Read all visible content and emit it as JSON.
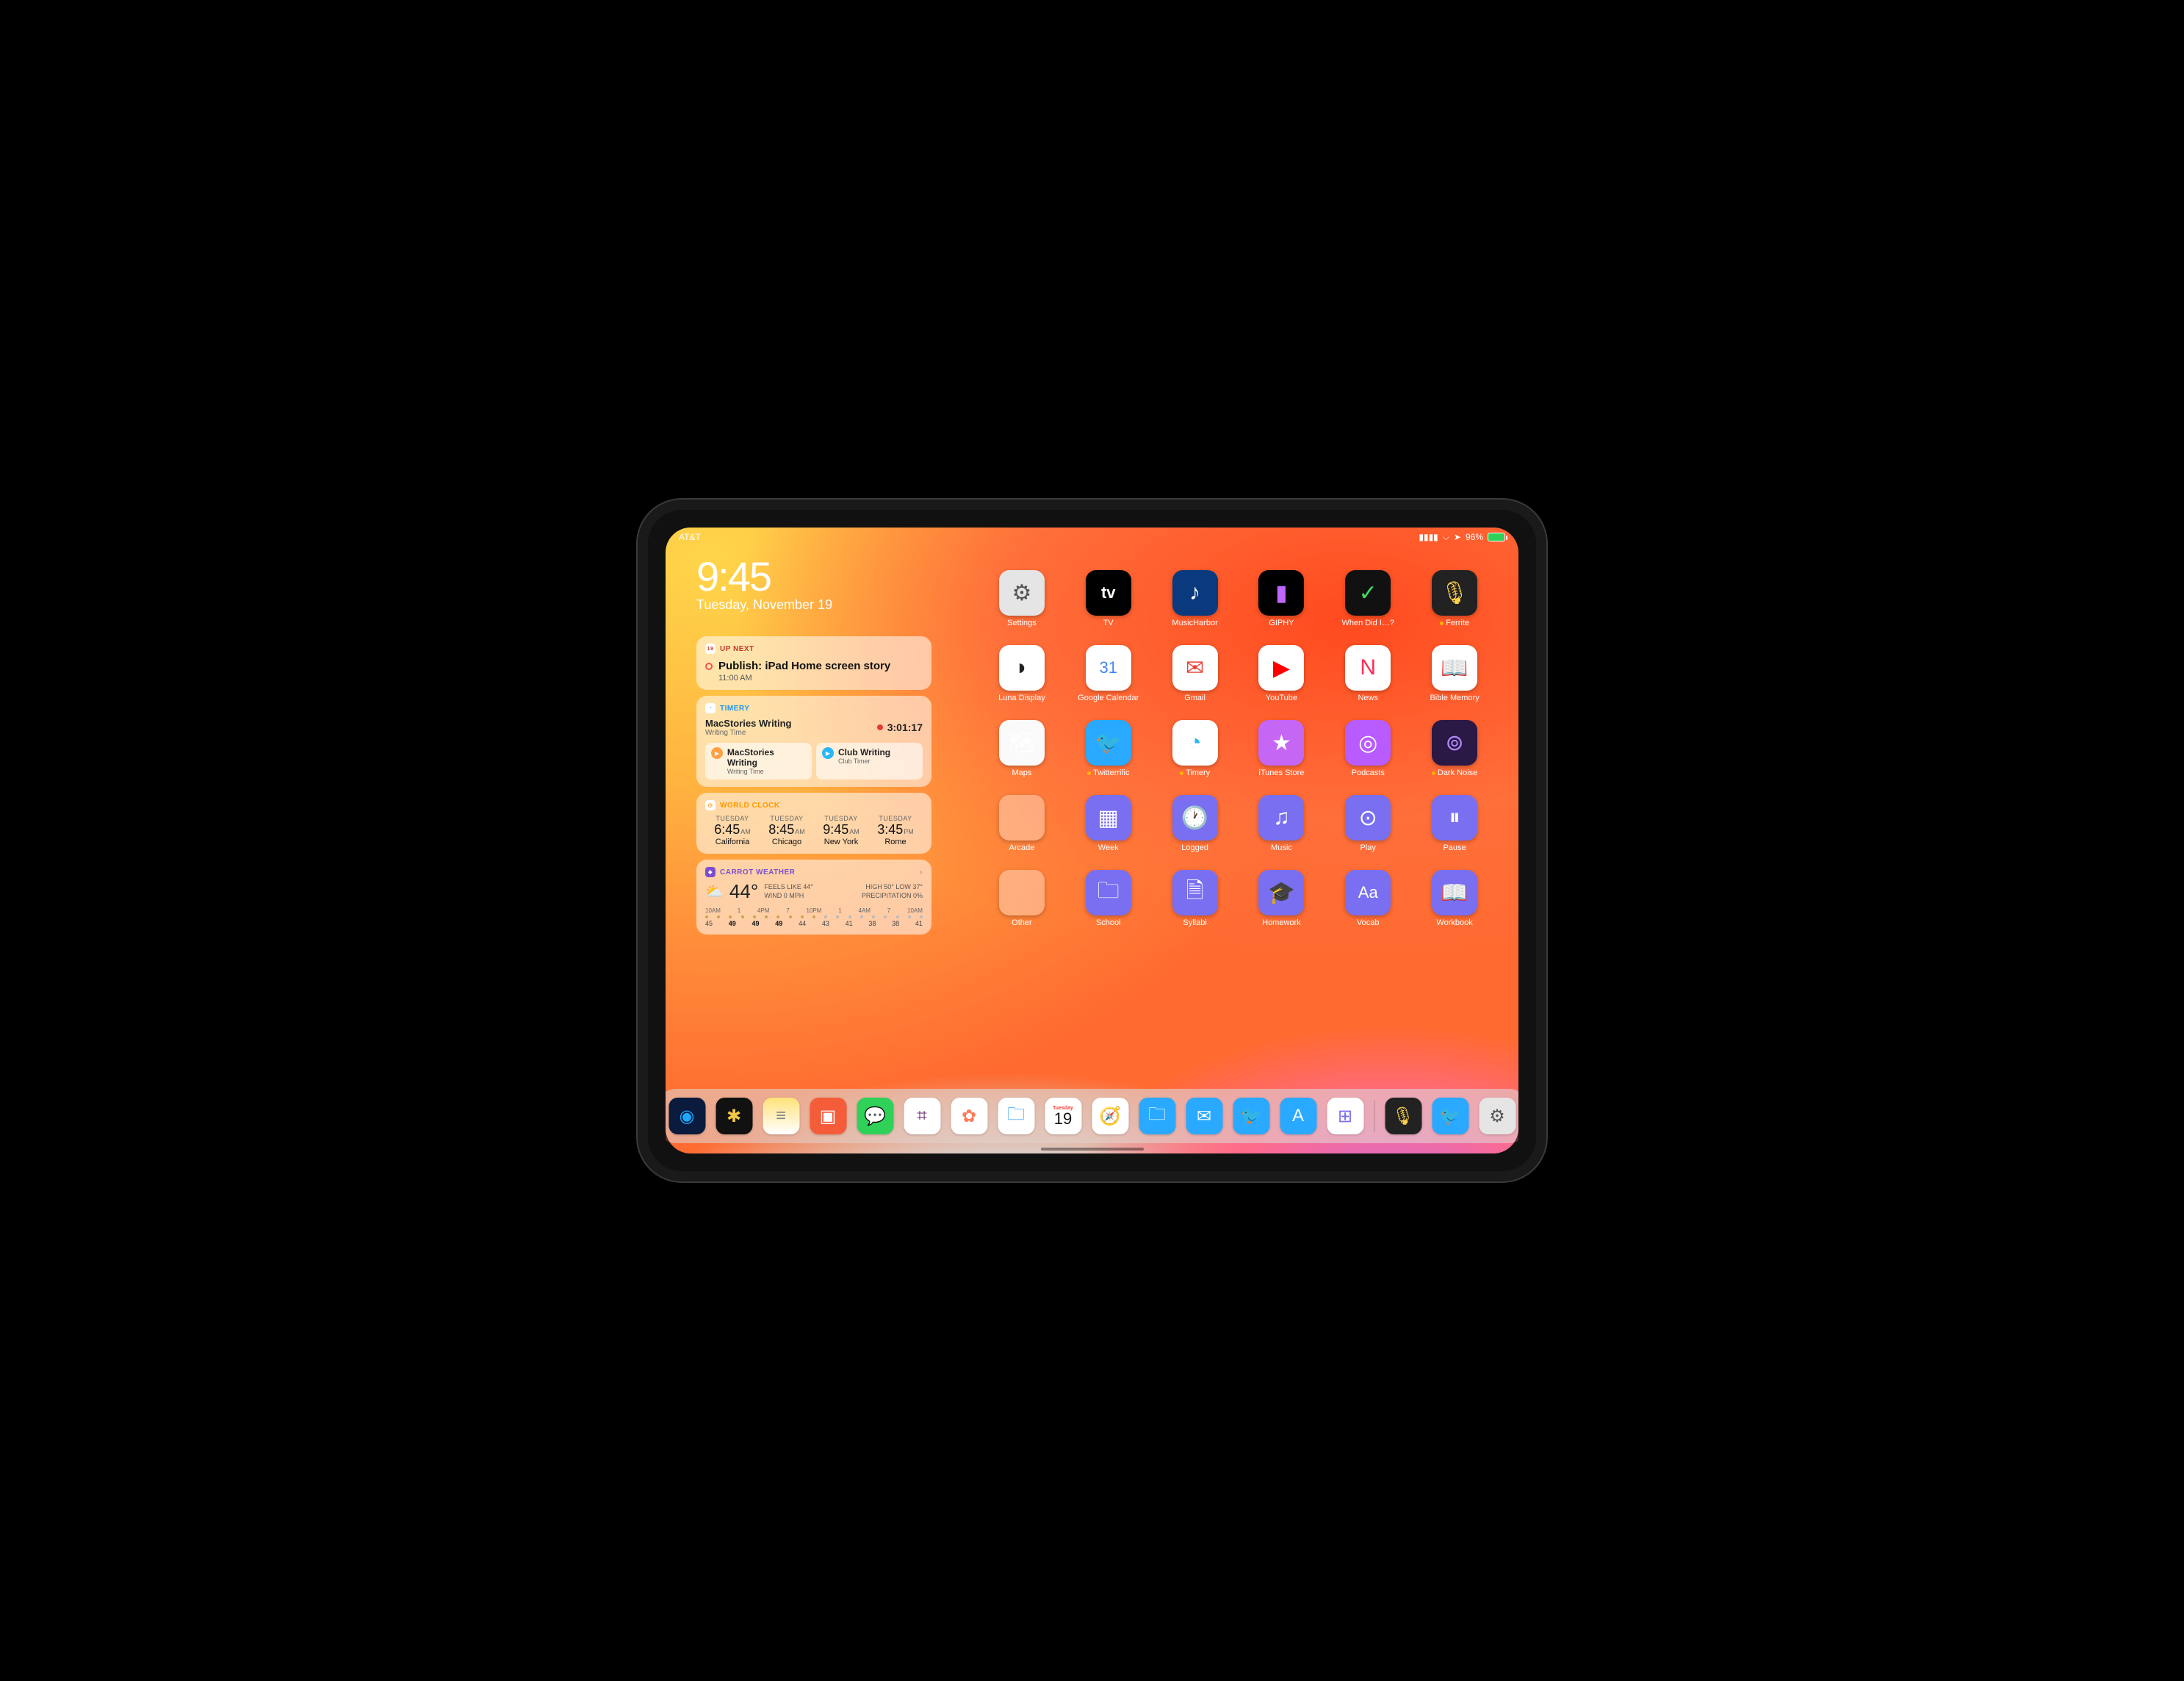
{
  "status": {
    "carrier": "AT&T",
    "battery_pct": "96%"
  },
  "clock": {
    "time": "9:45",
    "date": "Tuesday, November 19"
  },
  "widgets": {
    "upnext": {
      "label": "UP NEXT",
      "badge": "19",
      "event_title": "Publish: iPad Home screen story",
      "event_time": "11:00 AM"
    },
    "timery": {
      "label": "TIMERY",
      "project": "MacStories Writing",
      "task": "Writing Time",
      "elapsed": "3:01:17",
      "btn1_project": "MacStories Writing",
      "btn1_task": "Writing Time",
      "btn2_project": "Club Writing",
      "btn2_task": "Club Timer"
    },
    "worldclock": {
      "label": "WORLD CLOCK",
      "cities": [
        {
          "day": "TUESDAY",
          "time": "6:45",
          "ampm": "AM",
          "name": "California"
        },
        {
          "day": "TUESDAY",
          "time": "8:45",
          "ampm": "AM",
          "name": "Chicago"
        },
        {
          "day": "TUESDAY",
          "time": "9:45",
          "ampm": "AM",
          "name": "New York"
        },
        {
          "day": "TUESDAY",
          "time": "3:45",
          "ampm": "PM",
          "name": "Rome"
        }
      ]
    },
    "weather": {
      "label": "CARROT WEATHER",
      "temp": "44°",
      "feels": "FEELS LIKE 44°",
      "wind": "WIND 0 MPH",
      "high": "HIGH 50°",
      "low": "LOW 37°",
      "precip": "PRECIPITATION 0%",
      "hours": [
        "10AM",
        "1",
        "4PM",
        "7",
        "10PM",
        "1",
        "4AM",
        "7",
        "10AM"
      ],
      "temps": [
        "45",
        "49",
        "49",
        "49",
        "44",
        "43",
        "41",
        "38",
        "38",
        "41"
      ]
    }
  },
  "apps": [
    {
      "name": "Settings",
      "icon": "⚙",
      "bg": "#e5e5e5",
      "fg": "#555"
    },
    {
      "name": "TV",
      "icon": "tv",
      "bg": "#000"
    },
    {
      "name": "MusicHarbor",
      "icon": "♪",
      "bg": "#0a3a7d"
    },
    {
      "name": "GIPHY",
      "icon": "▮",
      "bg": "#000",
      "fg": "#c066ff"
    },
    {
      "name": "When Did I…?",
      "icon": "✓",
      "bg": "#111",
      "fg": "#40e060"
    },
    {
      "name": "Ferrite",
      "icon": "🎙",
      "bg": "#222",
      "fg": "#ffd24a",
      "ind": true
    },
    {
      "name": "Luna Display",
      "icon": "◗",
      "bg": "#fff",
      "fg": "#222"
    },
    {
      "name": "Google Calendar",
      "icon": "31",
      "bg": "#fff",
      "fg": "#4285f4"
    },
    {
      "name": "Gmail",
      "icon": "✉",
      "bg": "#fff",
      "fg": "#ea4335"
    },
    {
      "name": "YouTube",
      "icon": "▶",
      "bg": "#fff",
      "fg": "#ff0000"
    },
    {
      "name": "News",
      "icon": "N",
      "bg": "#fff",
      "fg": "#ff2d55"
    },
    {
      "name": "Bible Memory",
      "icon": "📖",
      "bg": "#fff",
      "fg": "#d9303a"
    },
    {
      "name": "Maps",
      "icon": "🗺",
      "bg": "#fafafa"
    },
    {
      "name": "Twitterrific",
      "icon": "🐦",
      "bg": "#29a9ff",
      "ind": true
    },
    {
      "name": "Timery",
      "icon": "◔",
      "bg": "#fff",
      "fg": "#29b6f6",
      "ind": true
    },
    {
      "name": "iTunes Store",
      "icon": "★",
      "bg": "#c566f5"
    },
    {
      "name": "Podcasts",
      "icon": "◎",
      "bg": "#b95cff"
    },
    {
      "name": "Dark Noise",
      "icon": "⊚",
      "bg": "#2a1845",
      "fg": "#b18cff",
      "ind": true
    },
    {
      "name": "Arcade",
      "folder": true
    },
    {
      "name": "Week",
      "icon": "▦",
      "bg": "#7a6ff0"
    },
    {
      "name": "Logged",
      "icon": "🕐",
      "bg": "#7a6ff0"
    },
    {
      "name": "Music",
      "icon": "♫",
      "bg": "#7a6ff0"
    },
    {
      "name": "Play",
      "icon": "⊙",
      "bg": "#7a6ff0"
    },
    {
      "name": "Pause",
      "icon": "⏸",
      "bg": "#7a6ff0"
    },
    {
      "name": "Other",
      "folder": true
    },
    {
      "name": "School",
      "icon": "🗀",
      "bg": "#7a6ff0"
    },
    {
      "name": "Syllabi",
      "icon": "🗎",
      "bg": "#7a6ff0"
    },
    {
      "name": "Homework",
      "icon": "🎓",
      "bg": "#7a6ff0"
    },
    {
      "name": "Vocab",
      "icon": "Aa",
      "bg": "#7a6ff0"
    },
    {
      "name": "Workbook",
      "icon": "📖",
      "bg": "#7a6ff0"
    }
  ],
  "dock": {
    "day": "Tuesday",
    "daynum": "19",
    "items": [
      {
        "name": "1Password",
        "bg": "#0a1b3d",
        "fg": "#1ea7fd",
        "icon": "◉"
      },
      {
        "name": "Day One",
        "bg": "#111",
        "fg": "#f2c744",
        "icon": "✱"
      },
      {
        "name": "Notes",
        "bg": "linear-gradient(#ffe27a,#fff)",
        "icon": "≡",
        "fg": "#888"
      },
      {
        "name": "Deliveries",
        "bg": "#f45c3a",
        "icon": "▣"
      },
      {
        "name": "Messages",
        "bg": "#30d158",
        "icon": "💬"
      },
      {
        "name": "Slack",
        "bg": "#fff",
        "icon": "⌗",
        "fg": "#611f69"
      },
      {
        "name": "Photos",
        "bg": "#fff",
        "icon": "✿",
        "fg": "#ff7a59"
      },
      {
        "name": "Files",
        "bg": "#fff",
        "icon": "🗀",
        "fg": "#2196f3"
      },
      {
        "name": "Calendar",
        "bg": "#fff",
        "icon": "cal"
      },
      {
        "name": "Safari",
        "bg": "#fff",
        "icon": "🧭",
        "fg": "#2196f3"
      },
      {
        "name": "Files2",
        "bg": "#29a9ff",
        "icon": "🗀"
      },
      {
        "name": "Mail",
        "bg": "#29a9ff",
        "icon": "✉"
      },
      {
        "name": "Twitter",
        "bg": "#29a9ff",
        "icon": "🐦"
      },
      {
        "name": "App Store",
        "bg": "#29a9ff",
        "icon": "A"
      },
      {
        "name": "Shortcuts",
        "bg": "#fff",
        "icon": "⊞",
        "fg": "#7a6ff0"
      }
    ],
    "recent": [
      {
        "name": "Ferrite",
        "bg": "#222",
        "icon": "🎙",
        "fg": "#ffd24a"
      },
      {
        "name": "Twitterrific",
        "bg": "#29a9ff",
        "icon": "🐦"
      },
      {
        "name": "Settings",
        "bg": "#e5e5e5",
        "icon": "⚙",
        "fg": "#555"
      }
    ]
  }
}
